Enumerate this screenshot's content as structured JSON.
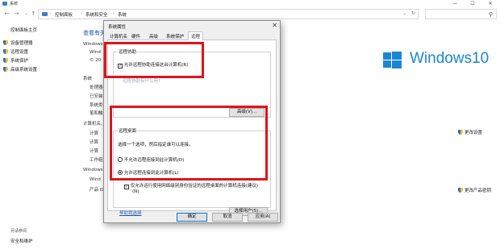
{
  "window": {
    "title": "系统",
    "minimize": "—",
    "maximize": "☐",
    "close": "✕"
  },
  "address_bar": {
    "back": "←",
    "forward": "→",
    "up": "↑",
    "breadcrumbs": [
      "控制面板",
      "系统和安全",
      "系统"
    ],
    "separator": "›",
    "search_icon": "search-icon"
  },
  "left_nav": {
    "home": "控制面板主页",
    "items": [
      "设备管理器",
      "远程设置",
      "系统保护",
      "高级系统设置"
    ],
    "see_also_heading": "另请参阅",
    "see_also_items": [
      "安全和维护"
    ]
  },
  "background": {
    "title": "查看有关",
    "lines": [
      "Windows",
      "Wind",
      "© 20",
      "系统",
      "处理器",
      "已安装",
      "系统类",
      "笔和触",
      "计算机名、",
      "计算",
      "计算",
      "计算",
      "工作组",
      "Windows",
      "Wind",
      "产品 ID"
    ],
    "logo_text": "Windows",
    "logo_number": "10",
    "change_settings": "更改设置",
    "change_product_key": "更改产品密钥"
  },
  "dialog": {
    "title": "系统属性",
    "close": "✕",
    "tabs": [
      "计算机名",
      "硬件",
      "高级",
      "系统保护",
      "远程"
    ],
    "active_tab": 4,
    "remote_assistance": {
      "group_title": "远程协助",
      "checkbox_label": "允许远程协助连接这台计算机(R)",
      "checked": true,
      "blur_link": "远程协助有什么用?",
      "advanced_button": "高级(V)..."
    },
    "remote_desktop": {
      "group_title": "远程桌面",
      "instruction": "选择一个选项，然后指定谁可以连接。",
      "option_1": "不允许远程连接到此计算机(D)",
      "option_2": "允许远程连接到此计算机(L)",
      "selected_option": 2,
      "nla_checkbox_line1": "仅允许运行使用网络级别身份验证的远程桌面的计算机连接(建议)",
      "nla_checkbox_line2": "(N)",
      "nla_checked": true,
      "help_link": "帮助我选择",
      "select_users_button": "选择用户(S)..."
    },
    "buttons": {
      "ok": "确定",
      "cancel": "取消",
      "apply": "应用(A)"
    }
  },
  "colors": {
    "accent": "#1b86d1",
    "highlight_box": "#e0141c",
    "link": "#1e5aa8"
  }
}
